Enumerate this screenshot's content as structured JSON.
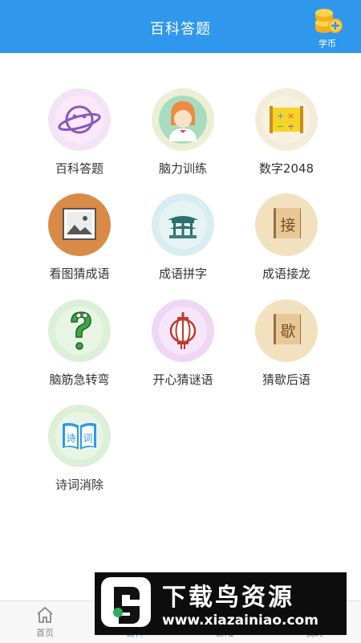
{
  "header": {
    "title": "百科答题",
    "coins_label": "学币"
  },
  "grid": {
    "items": [
      {
        "label": "百科答题",
        "icon": "planet-icon",
        "bg": "#f3e3f6"
      },
      {
        "label": "脑力训练",
        "icon": "person-icon",
        "bg": "#ecefd5"
      },
      {
        "label": "数字2048",
        "icon": "math-board-icon",
        "bg": "#f3ecd9"
      },
      {
        "label": "看图猜成语",
        "icon": "picture-icon",
        "bg": "#d88a46"
      },
      {
        "label": "成语拼字",
        "icon": "pavilion-icon",
        "bg": "#d8edf1"
      },
      {
        "label": "成语接龙",
        "icon": "book-jie-icon",
        "bg": "#f1e1bf"
      },
      {
        "label": "脑筋急转弯",
        "icon": "question-mark-icon",
        "bg": "#dcefd7"
      },
      {
        "label": "开心猜谜语",
        "icon": "lantern-icon",
        "bg": "#eed7f4"
      },
      {
        "label": "猜歇后语",
        "icon": "book-xie-icon",
        "bg": "#f1e1bf"
      },
      {
        "label": "诗词消除",
        "icon": "poetry-book-icon",
        "bg": "#dcefd7"
      }
    ]
  },
  "book_chars": {
    "jie": "接",
    "xie": "歇"
  },
  "poetry_chars": {
    "left": "诗",
    "right": "词"
  },
  "tabbar": {
    "tabs": [
      {
        "label": "首页",
        "icon": "home-icon",
        "active": false
      },
      {
        "label": "百科",
        "icon": "book-tab-icon",
        "active": true
      },
      {
        "label": "游戏",
        "icon": "game-icon",
        "active": false
      },
      {
        "label": "我的",
        "icon": "user-icon",
        "active": false
      }
    ]
  },
  "watermark": {
    "brand": "下载鸟资源",
    "url": "www.xiazainiao.com"
  },
  "colors": {
    "primary": "#2f97ec",
    "text": "#333333"
  }
}
